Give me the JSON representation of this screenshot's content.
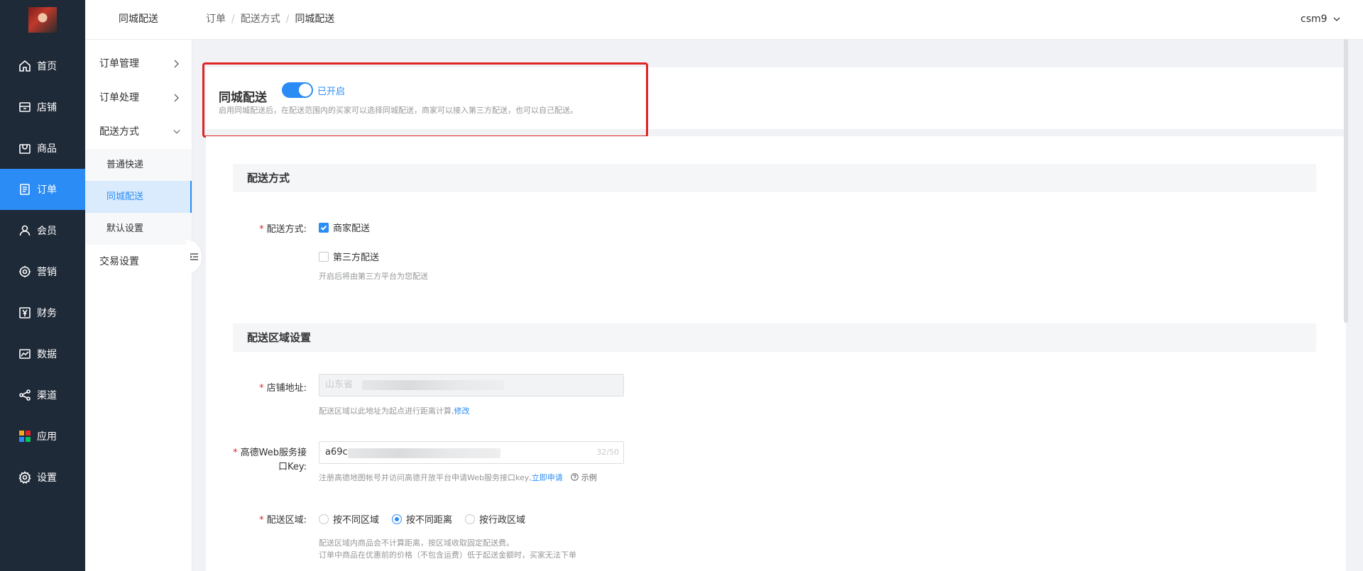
{
  "nav": {
    "items": [
      {
        "label": "首页",
        "icon": "home-icon"
      },
      {
        "label": "店铺",
        "icon": "shop-icon"
      },
      {
        "label": "商品",
        "icon": "goods-icon"
      },
      {
        "label": "订单",
        "icon": "order-icon"
      },
      {
        "label": "会员",
        "icon": "member-icon"
      },
      {
        "label": "营销",
        "icon": "marketing-icon"
      },
      {
        "label": "财务",
        "icon": "finance-icon"
      },
      {
        "label": "数据",
        "icon": "data-icon"
      },
      {
        "label": "渠道",
        "icon": "channel-icon"
      },
      {
        "label": "应用",
        "icon": "apps-icon"
      },
      {
        "label": "设置",
        "icon": "settings-icon"
      }
    ],
    "active_index": 3
  },
  "subnav": {
    "title": "同城配送",
    "groups": [
      {
        "label": "订单管理"
      },
      {
        "label": "订单处理"
      },
      {
        "label": "配送方式"
      },
      {
        "label": "交易设置"
      }
    ],
    "sub_items": [
      {
        "label": "普通快递"
      },
      {
        "label": "同城配送"
      },
      {
        "label": "默认设置"
      }
    ]
  },
  "header": {
    "breadcrumb": [
      "订单",
      "配送方式",
      "同城配送"
    ],
    "user": "csm9"
  },
  "toggle": {
    "title": "同城配送",
    "state_label": "已开启",
    "enabled": true,
    "description": "启用同城配送后，在配送范围内的买家可以选择同城配送，商家可以接入第三方配送，也可以自己配送。"
  },
  "sections": {
    "delivery_method": {
      "heading": "配送方式",
      "label": "配送方式:",
      "options": [
        {
          "label": "商家配送",
          "checked": true
        },
        {
          "label": "第三方配送",
          "checked": false
        }
      ],
      "hint": "开启后将由第三方平台为您配送"
    },
    "area": {
      "heading": "配送区域设置",
      "address_label": "店铺地址:",
      "address_value": "山东省",
      "address_hint": "配送区域以此地址为起点进行距离计算,",
      "address_hint_link": "修改",
      "key_label_1": "高德Web服务接",
      "key_label_2": "口Key:",
      "key_value": "a69c",
      "key_counter": "32/50",
      "key_hint": "注册高德地图帐号并访问高德开放平台申请Web服务接口key,",
      "key_hint_link": "立即申请",
      "key_example": "示例",
      "region_label": "配送区域:",
      "region_options": [
        {
          "label": "按不同区域",
          "selected": false
        },
        {
          "label": "按不同距离",
          "selected": true
        },
        {
          "label": "按行政区域",
          "selected": false
        }
      ],
      "region_hint_1": "配送区域内商品会不计算距离，按区域收取固定配送费。",
      "region_hint_2": "订单中商品在优惠前的价格（不包含运费）低于起送金额时，买家无法下单"
    }
  },
  "colors": {
    "accent": "#2b8cf5",
    "nav_bg": "#1f2a38",
    "highlight": "#e02424"
  }
}
